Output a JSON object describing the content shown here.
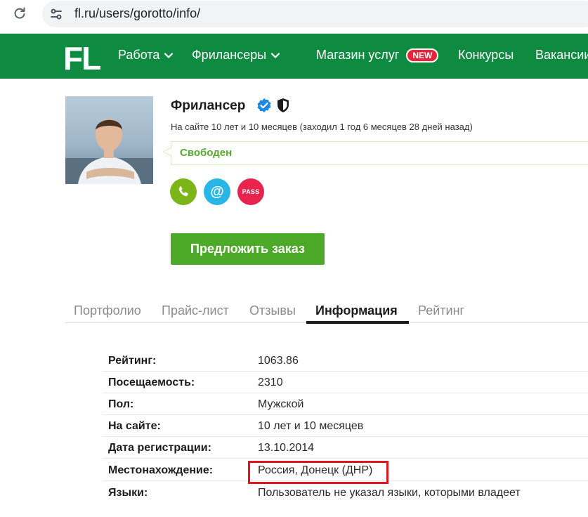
{
  "browser": {
    "url": "fl.ru/users/gorotto/info/"
  },
  "nav": {
    "logo": "FL",
    "items": [
      {
        "label": "Работа",
        "dropdown": true
      },
      {
        "label": "Фрилансеры",
        "dropdown": true
      },
      {
        "label": "Магазин услуг",
        "badge": "NEW"
      },
      {
        "label": "Конкурсы"
      },
      {
        "label": "Вакансии"
      }
    ],
    "bg_color": "#0f8a41"
  },
  "profile": {
    "name": "Фрилансер",
    "since": "На сайте 10 лет и 10 месяцев (заходил 1 год 6 месяцев 28 дней назад)",
    "status": "Свободен",
    "contacts": {
      "phone_icon": "phone-icon",
      "email_label": "@",
      "pass_label": "PASS"
    },
    "order_button": "Предложить заказ"
  },
  "tabs": [
    {
      "label": "Портфолио",
      "active": false
    },
    {
      "label": "Прайс-лист",
      "active": false
    },
    {
      "label": "Отзывы",
      "active": false
    },
    {
      "label": "Информация",
      "active": true
    },
    {
      "label": "Рейтинг",
      "active": false
    }
  ],
  "info": [
    {
      "label": "Рейтинг:",
      "value": "1063.86"
    },
    {
      "label": "Посещаемость:",
      "value": "2310"
    },
    {
      "label": "Пол:",
      "value": "Мужской"
    },
    {
      "label": "На сайте:",
      "value": "10 лет и 10 месяцев"
    },
    {
      "label": "Дата регистрации:",
      "value": "13.10.2014"
    },
    {
      "label": "Местонахождение:",
      "value": "Россия, Донецк (ДНР)",
      "highlighted": true
    },
    {
      "label": "Языки:",
      "value": "Пользователь не указал языки, которыми владеет"
    }
  ],
  "colors": {
    "brand_green": "#0f8a41",
    "button_green": "#4caa28",
    "status_green": "#55aa30",
    "highlight_red": "#e0161d"
  }
}
